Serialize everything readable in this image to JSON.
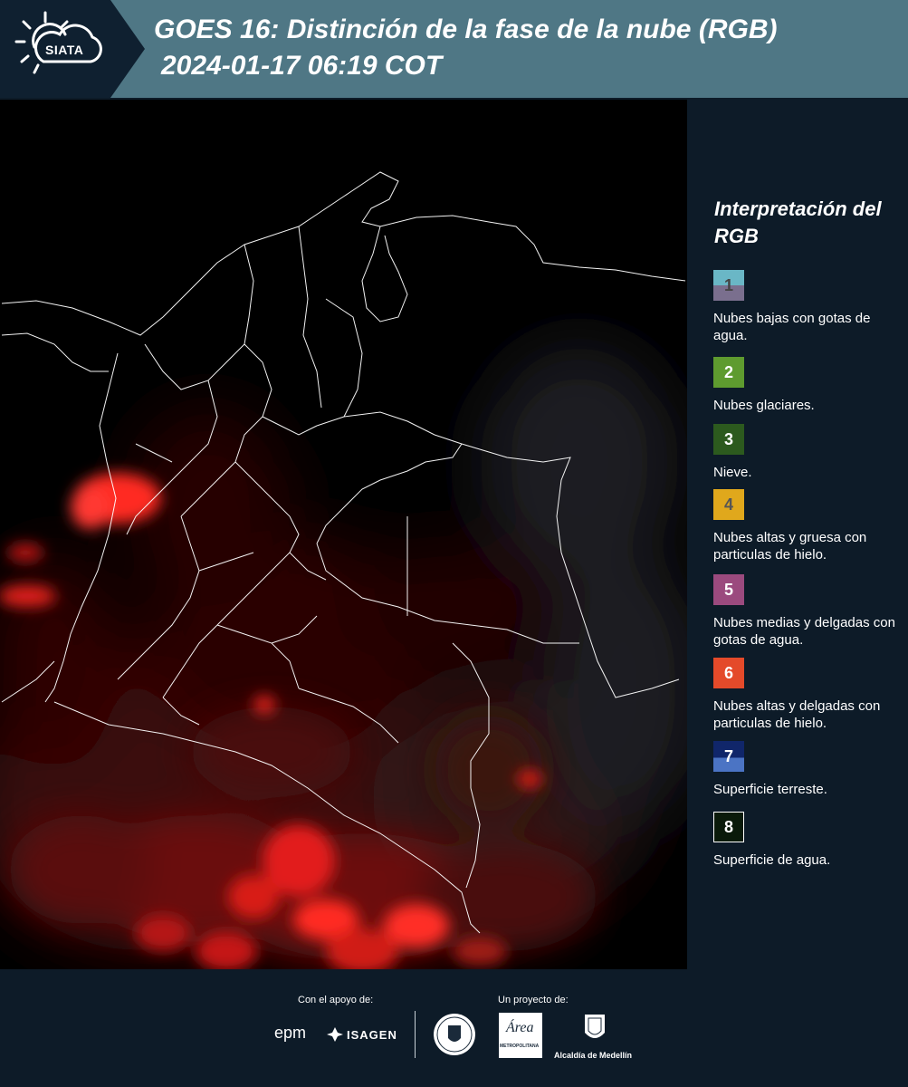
{
  "header": {
    "logo_text": "SIATA",
    "title": "GOES 16: Distinción de la fase de la nube (RGB)",
    "subtitle": "2024-01-17 06:19 COT"
  },
  "legend": {
    "title": "Interpretación del RGB",
    "items": [
      {
        "number": "1",
        "label": "Nubes bajas con gotas de agua.",
        "color_top": "#6ab7c6",
        "color_bottom": "#7a6f8e",
        "text_color": "#444444"
      },
      {
        "number": "2",
        "label": "Nubes glaciares.",
        "color_top": "#5e9b2f",
        "color_bottom": "#5e9b2f",
        "text_color": "#ffffff"
      },
      {
        "number": "3",
        "label": "Nieve.",
        "color_top": "#2c5a1e",
        "color_bottom": "#2c5a1e",
        "text_color": "#ffffff"
      },
      {
        "number": "4",
        "label": "Nubes altas y gruesa con particulas de hielo.",
        "color_top": "#e0a81c",
        "color_bottom": "#e0a81c",
        "text_color": "#555555"
      },
      {
        "number": "5",
        "label": "Nubes medias y delgadas con gotas de agua.",
        "color_top": "#9b4a7e",
        "color_bottom": "#9b4a7e",
        "text_color": "#ffffff"
      },
      {
        "number": "6",
        "label": "Nubes altas y delgadas con particulas de hielo.",
        "color_top": "#e44a2a",
        "color_bottom": "#e44a2a",
        "text_color": "#ffffff"
      },
      {
        "number": "7",
        "label": "Superficie terreste.",
        "color_top": "#10266a",
        "color_bottom": "#4b74c4",
        "text_color": "#ffffff"
      },
      {
        "number": "8",
        "label": "Superficie de agua.",
        "color_top": "#0a1a0a",
        "color_bottom": "#0a1a0a",
        "text_color": "#ffffff"
      }
    ]
  },
  "footer": {
    "support_label": "Con el apoyo de:",
    "project_label": "Un proyecto de:",
    "sponsor_1": "epm",
    "sponsor_2": "ISAGEN",
    "partner_area": "Área",
    "partner_area_sub": "METROPOLITANA",
    "partner_alcaldia": "Alcaldía de Medellín"
  }
}
